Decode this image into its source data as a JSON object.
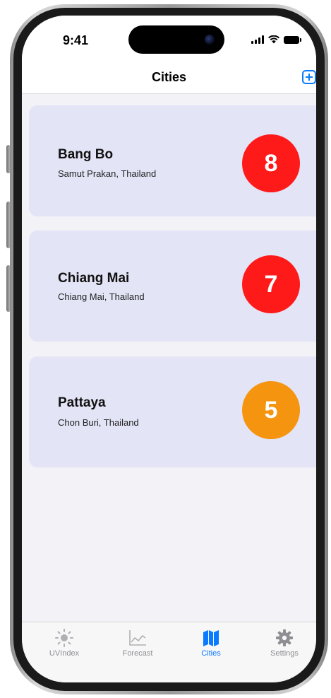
{
  "status_bar": {
    "time": "9:41"
  },
  "nav": {
    "title": "Cities"
  },
  "cities": [
    {
      "name": "Bang Bo",
      "region": "Samut Prakan, Thailand",
      "uv": "8",
      "color": "#ff1a1a"
    },
    {
      "name": "Chiang Mai",
      "region": "Chiang Mai, Thailand",
      "uv": "7",
      "color": "#ff1a1a"
    },
    {
      "name": "Pattaya",
      "region": "Chon Buri, Thailand",
      "uv": "5",
      "color": "#f5940f"
    }
  ],
  "tabs": [
    {
      "label": "UVIndex",
      "icon": "sun-icon"
    },
    {
      "label": "Forecast",
      "icon": "chart-icon"
    },
    {
      "label": "Cities",
      "icon": "map-icon",
      "active": true
    },
    {
      "label": "Settings",
      "icon": "gear-icon"
    }
  ],
  "colors": {
    "accent": "#0a7aff",
    "card": "#e3e4f6",
    "inactive": "#8e8e93"
  }
}
